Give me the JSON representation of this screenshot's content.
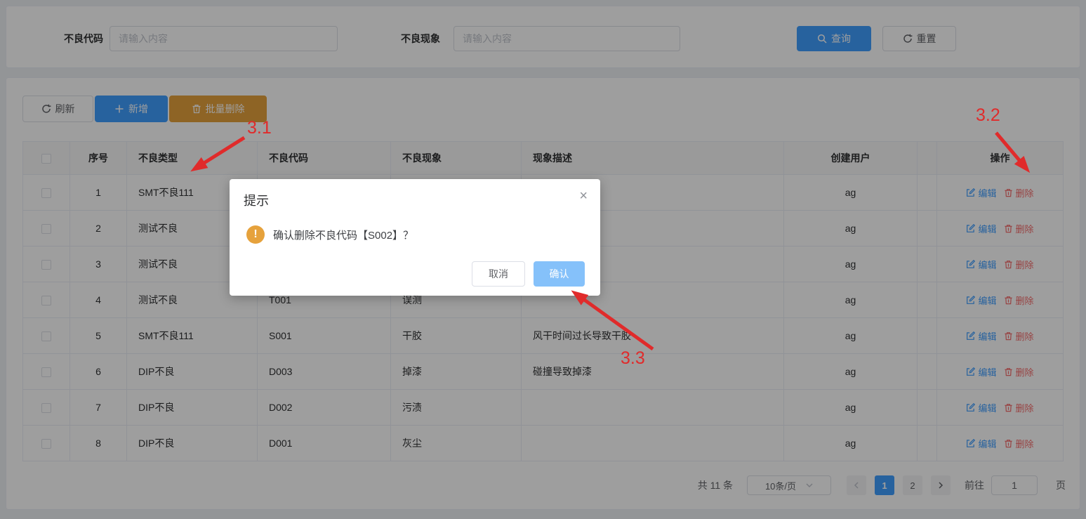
{
  "search": {
    "code_label": "不良代码",
    "code_placeholder": "请输入内容",
    "phenomenon_label": "不良现象",
    "phenomenon_placeholder": "请输入内容",
    "query_label": "查询",
    "reset_label": "重置"
  },
  "toolbar": {
    "refresh_label": "刷新",
    "add_label": "新增",
    "batch_delete_label": "批量删除"
  },
  "table": {
    "headers": {
      "index": "序号",
      "type": "不良类型",
      "code": "不良代码",
      "phenomenon": "不良现象",
      "description": "现象描述",
      "creator": "创建用户",
      "actions": "操作"
    },
    "edit_label": "编辑",
    "delete_label": "删除",
    "rows": [
      {
        "index": "1",
        "type": "SMT不良111",
        "code": "",
        "phenomenon": "",
        "description": "",
        "creator": "ag"
      },
      {
        "index": "2",
        "type": "测试不良",
        "code": "",
        "phenomenon": "",
        "description": "",
        "creator": "ag"
      },
      {
        "index": "3",
        "type": "测试不良",
        "code": "",
        "phenomenon": "",
        "description": "",
        "creator": "ag"
      },
      {
        "index": "4",
        "type": "测试不良",
        "code": "T001",
        "phenomenon": "误测",
        "description": "",
        "creator": "ag"
      },
      {
        "index": "5",
        "type": "SMT不良111",
        "code": "S001",
        "phenomenon": "干胶",
        "description": "风干时间过长导致干胶",
        "creator": "ag"
      },
      {
        "index": "6",
        "type": "DIP不良",
        "code": "D003",
        "phenomenon": "掉漆",
        "description": "碰撞导致掉漆",
        "creator": "ag"
      },
      {
        "index": "7",
        "type": "DIP不良",
        "code": "D002",
        "phenomenon": "污渍",
        "description": "",
        "creator": "ag"
      },
      {
        "index": "8",
        "type": "DIP不良",
        "code": "D001",
        "phenomenon": "灰尘",
        "description": "",
        "creator": "ag"
      }
    ]
  },
  "dialog": {
    "title": "提示",
    "message": "确认删除不良代码【S002】？",
    "cancel_label": "取消",
    "confirm_label": "确认",
    "close_glyph": "×"
  },
  "pagination": {
    "total": "共 11 条",
    "page_size": "10条/页",
    "page1": "1",
    "page2": "2",
    "goto_label": "前往",
    "goto_value": "1",
    "unit_label": "页"
  },
  "annotations": {
    "a1": "3.1",
    "a2": "3.2",
    "a3": "3.3"
  },
  "colors": {
    "primary": "#409EFF",
    "warning": "#E6A23C",
    "danger": "#F56C6C",
    "confirm_button": "#85c1fa",
    "annotation_red": "#e02b2b"
  }
}
